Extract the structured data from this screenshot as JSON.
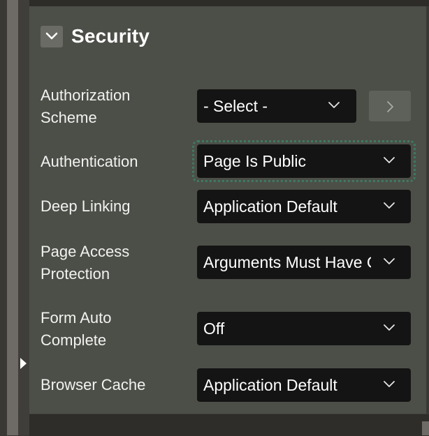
{
  "section": {
    "title": "Security",
    "collapse_icon": "chevron-down-icon"
  },
  "fields": [
    {
      "label": "Authorization Scheme",
      "value": "- Select -"
    },
    {
      "label": "Authentication",
      "value": "Page Is Public"
    },
    {
      "label": "Deep Linking",
      "value": "Application Default"
    },
    {
      "label": "Page Access Protection",
      "value": "Arguments Must Have Checksum"
    },
    {
      "label": "Form Auto Complete",
      "value": "Off"
    },
    {
      "label": "Browser Cache",
      "value": "Application Default"
    }
  ],
  "colors": {
    "panel": "#4c4f48",
    "select_bg": "#141414",
    "focus_ring": "#3e7a63",
    "text": "#ffffff"
  }
}
